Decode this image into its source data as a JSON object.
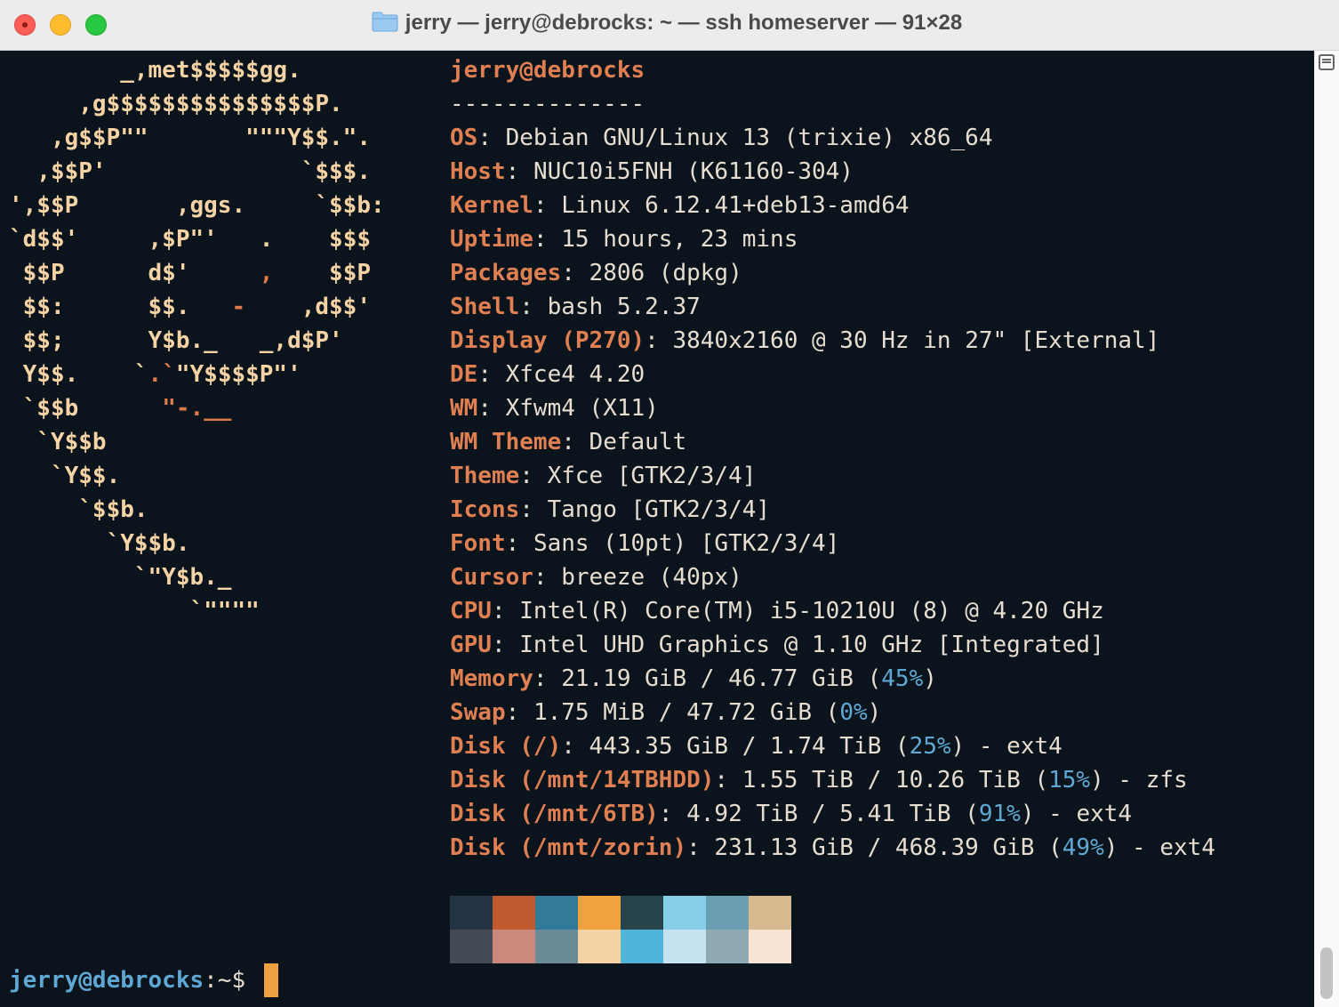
{
  "window": {
    "title": "jerry — jerry@debrocks: ~ — ssh homeserver — 91×28"
  },
  "logo_lines": [
    "        _,met$$$$$gg.",
    "     ,g$$$$$$$$$$$$$$$P.",
    "   ,g$$P\"\"       \"\"\"Y$$.\".",
    "  ,$$P'              `$$$.",
    "',$$P       ,ggs.     `$$b:",
    "`d$$'     ,$P\"'   .    $$$",
    " $$P      d$'     ,    $$P",
    " $$:      $$.   -    ,d$$'",
    " $$;      Y$b._   _,d$P'",
    " Y$$.    `.`\"Y$$$$P\"'",
    " `$$b      \"-.__",
    "  `Y$$b",
    "   `Y$$.",
    "     `$$b.",
    "       `Y$$b.",
    "         `\"Y$b._",
    "             `\"\"\"\""
  ],
  "info": {
    "user_host": "jerry@debrocks",
    "separator": "--------------",
    "rows": [
      {
        "key": "OS",
        "value": "Debian GNU/Linux 13 (trixie) x86_64"
      },
      {
        "key": "Host",
        "value": "NUC10i5FNH (K61160-304)"
      },
      {
        "key": "Kernel",
        "value": "Linux 6.12.41+deb13-amd64"
      },
      {
        "key": "Uptime",
        "value": "15 hours, 23 mins"
      },
      {
        "key": "Packages",
        "value": "2806 (dpkg)"
      },
      {
        "key": "Shell",
        "value": "bash 5.2.37"
      },
      {
        "key": "Display (P270)",
        "value": "3840x2160 @ 30 Hz in 27\" [External]"
      },
      {
        "key": "DE",
        "value": "Xfce4 4.20"
      },
      {
        "key": "WM",
        "value": "Xfwm4 (X11)"
      },
      {
        "key": "WM Theme",
        "value": "Default"
      },
      {
        "key": "Theme",
        "value": "Xfce [GTK2/3/4]"
      },
      {
        "key": "Icons",
        "value": "Tango [GTK2/3/4]"
      },
      {
        "key": "Font",
        "value": "Sans (10pt) [GTK2/3/4]"
      },
      {
        "key": "Cursor",
        "value": "breeze (40px)"
      },
      {
        "key": "CPU",
        "value": "Intel(R) Core(TM) i5-10210U (8) @ 4.20 GHz"
      },
      {
        "key": "GPU",
        "value": "Intel UHD Graphics @ 1.10 GHz [Integrated]"
      }
    ],
    "usage_rows": [
      {
        "key": "Memory",
        "pre": "21.19 GiB / 46.77 GiB (",
        "pct": "45%",
        "post": ")"
      },
      {
        "key": "Swap",
        "pre": "1.75 MiB / 47.72 GiB (",
        "pct": "0%",
        "post": ")"
      },
      {
        "key": "Disk (/)",
        "pre": "443.35 GiB / 1.74 TiB (",
        "pct": "25%",
        "post": ") - ext4"
      },
      {
        "key": "Disk (/mnt/14TBHDD)",
        "pre": "1.55 TiB / 10.26 TiB (",
        "pct": "15%",
        "post": ") - zfs"
      },
      {
        "key": "Disk (/mnt/6TB)",
        "pre": "4.92 TiB / 5.41 TiB (",
        "pct": "91%",
        "post": ") - ext4"
      },
      {
        "key": "Disk (/mnt/zorin)",
        "pre": "231.13 GiB / 468.39 GiB (",
        "pct": "49%",
        "post": ") - ext4"
      }
    ]
  },
  "palette": {
    "top": [
      "#233445",
      "#c25a30",
      "#327a98",
      "#f0a240",
      "#27434c",
      "#86cfe9",
      "#6a9fb1",
      "#d6b98f"
    ],
    "bottom": [
      "#434a55",
      "#c98a7d",
      "#6a8c98",
      "#f6d3a4",
      "#50b3d8",
      "#c5e2ee",
      "#8fa9b3",
      "#f8e4d2"
    ]
  },
  "prompt": {
    "user_host": "jerry@debrocks",
    "rest": ":~$"
  },
  "colors": {
    "background": "#0b141c",
    "key": "#df7f52",
    "logo": "#f5d3a4",
    "percent": "#5fa8d3",
    "cursor": "#f0a040"
  }
}
